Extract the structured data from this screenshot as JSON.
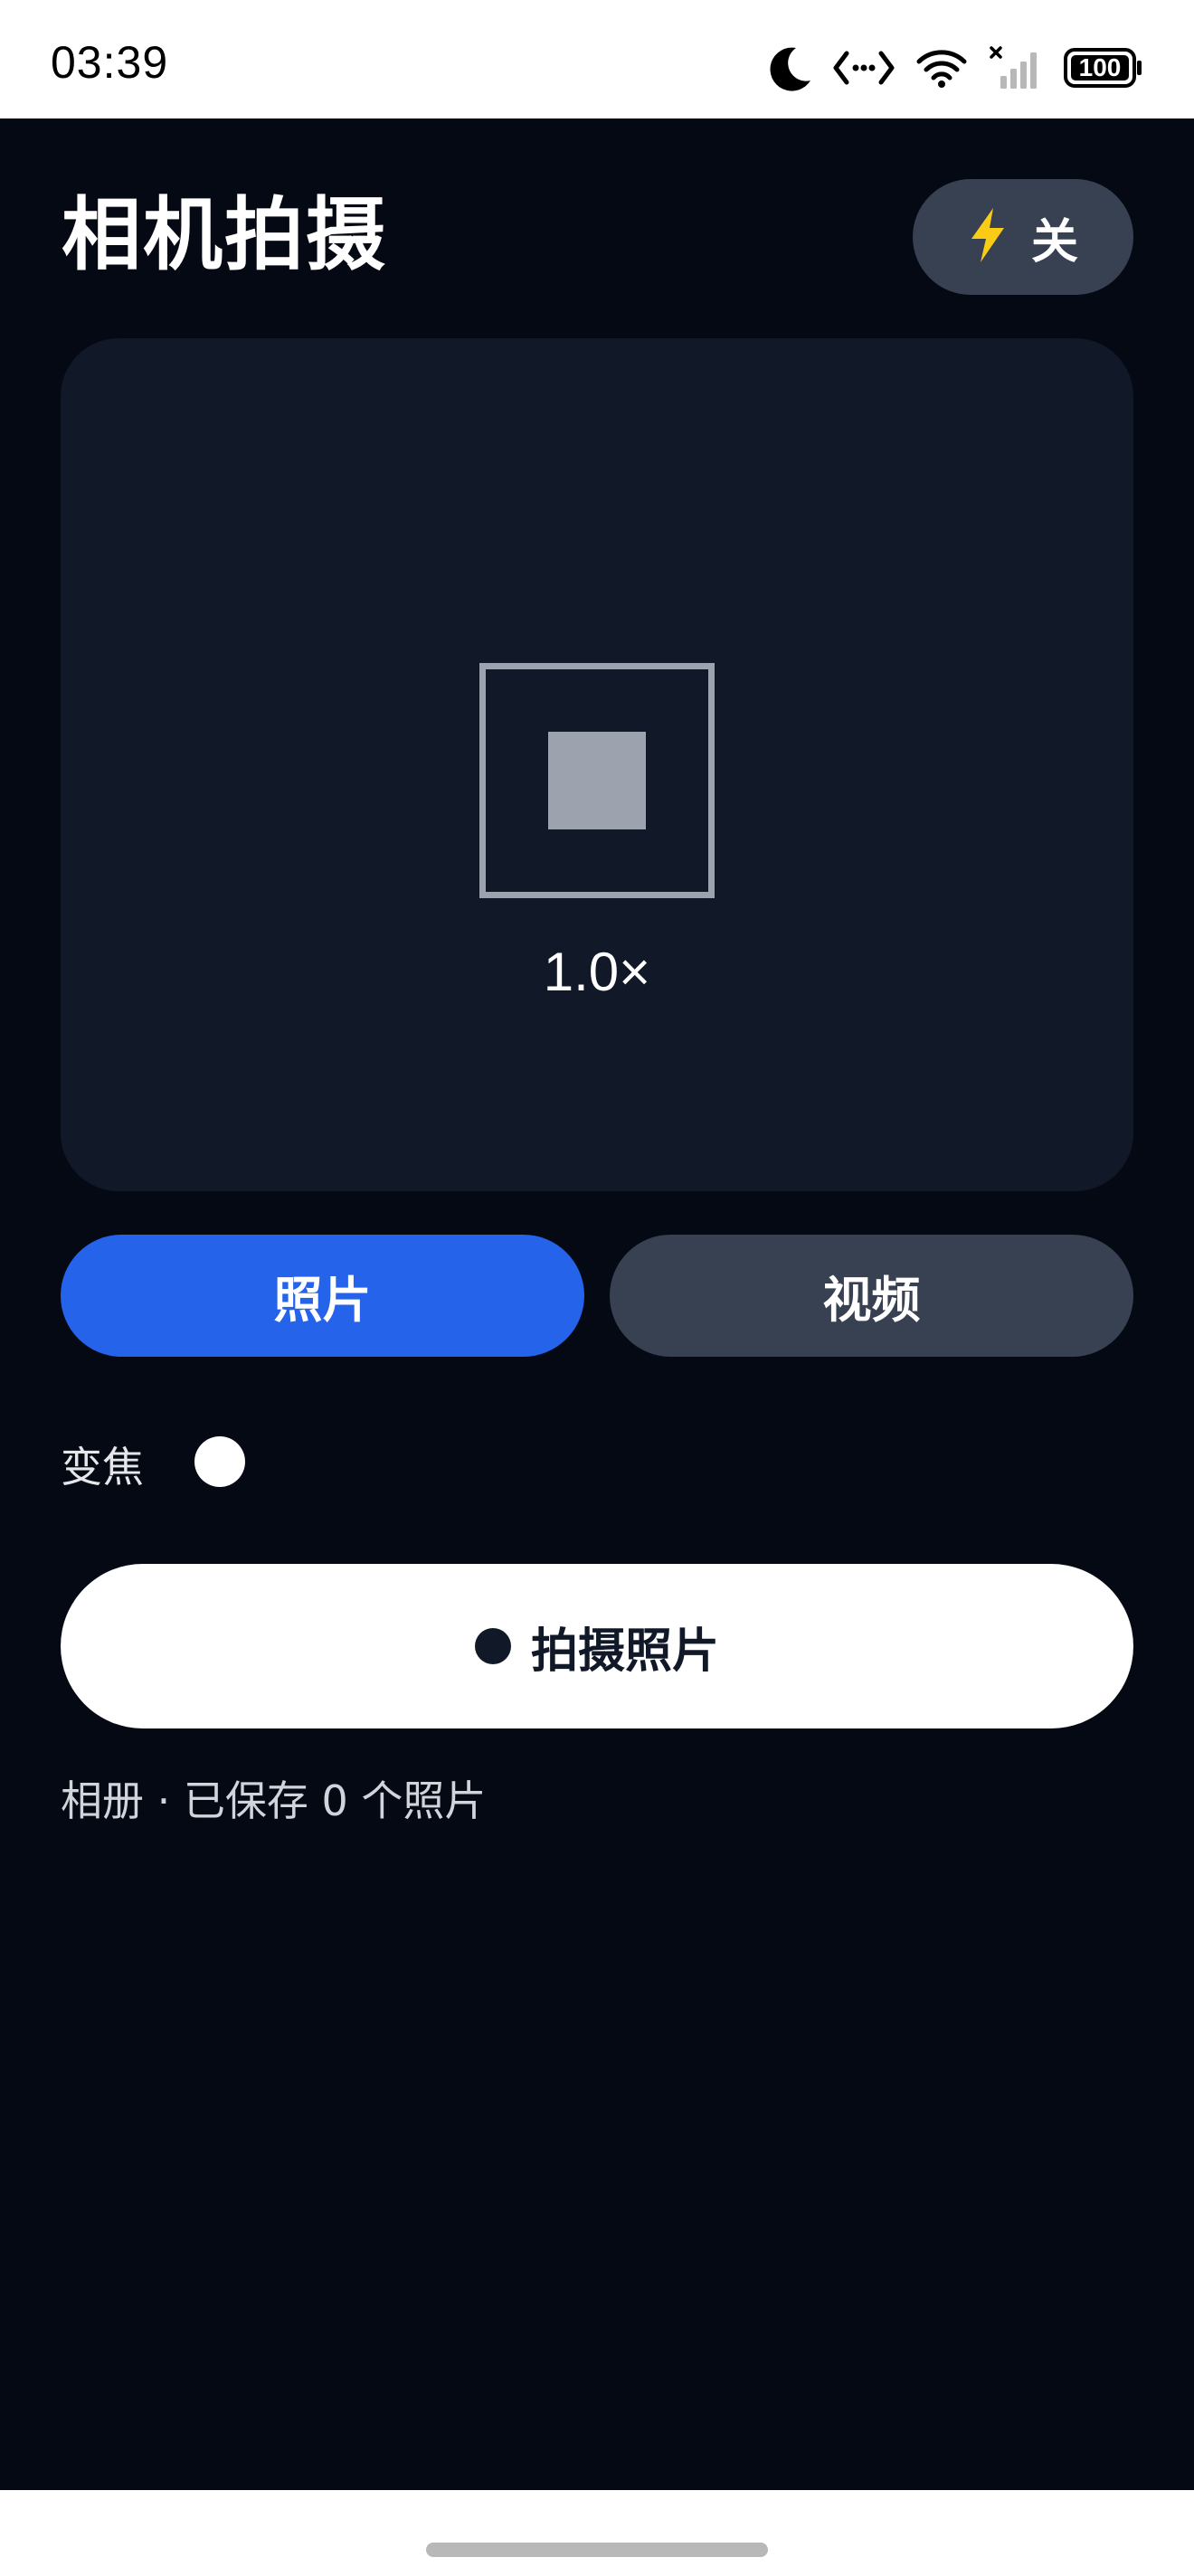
{
  "status_bar": {
    "time": "03:39",
    "battery": "100",
    "icons": [
      "moon-icon",
      "data-transfer-icon",
      "wifi-icon",
      "signal-icon",
      "battery-icon"
    ]
  },
  "header": {
    "title": "相机拍摄",
    "flash": {
      "icon": "lightning-icon",
      "label": "关"
    }
  },
  "viewfinder": {
    "icon": "focus-frame-icon",
    "zoom_level": "1.0×"
  },
  "mode_tabs": [
    {
      "label": "照片",
      "active": true
    },
    {
      "label": "视频",
      "active": false
    }
  ],
  "zoom_control": {
    "label": "变焦"
  },
  "shutter": {
    "label": "拍摄照片"
  },
  "album": {
    "status": "相册 · 已保存 0 个照片"
  },
  "colors": {
    "background": "#050914",
    "viewfinder": "#111827",
    "active_tab": "#2563eb",
    "inactive_tab": "#374151",
    "flash_icon": "#facc15"
  }
}
